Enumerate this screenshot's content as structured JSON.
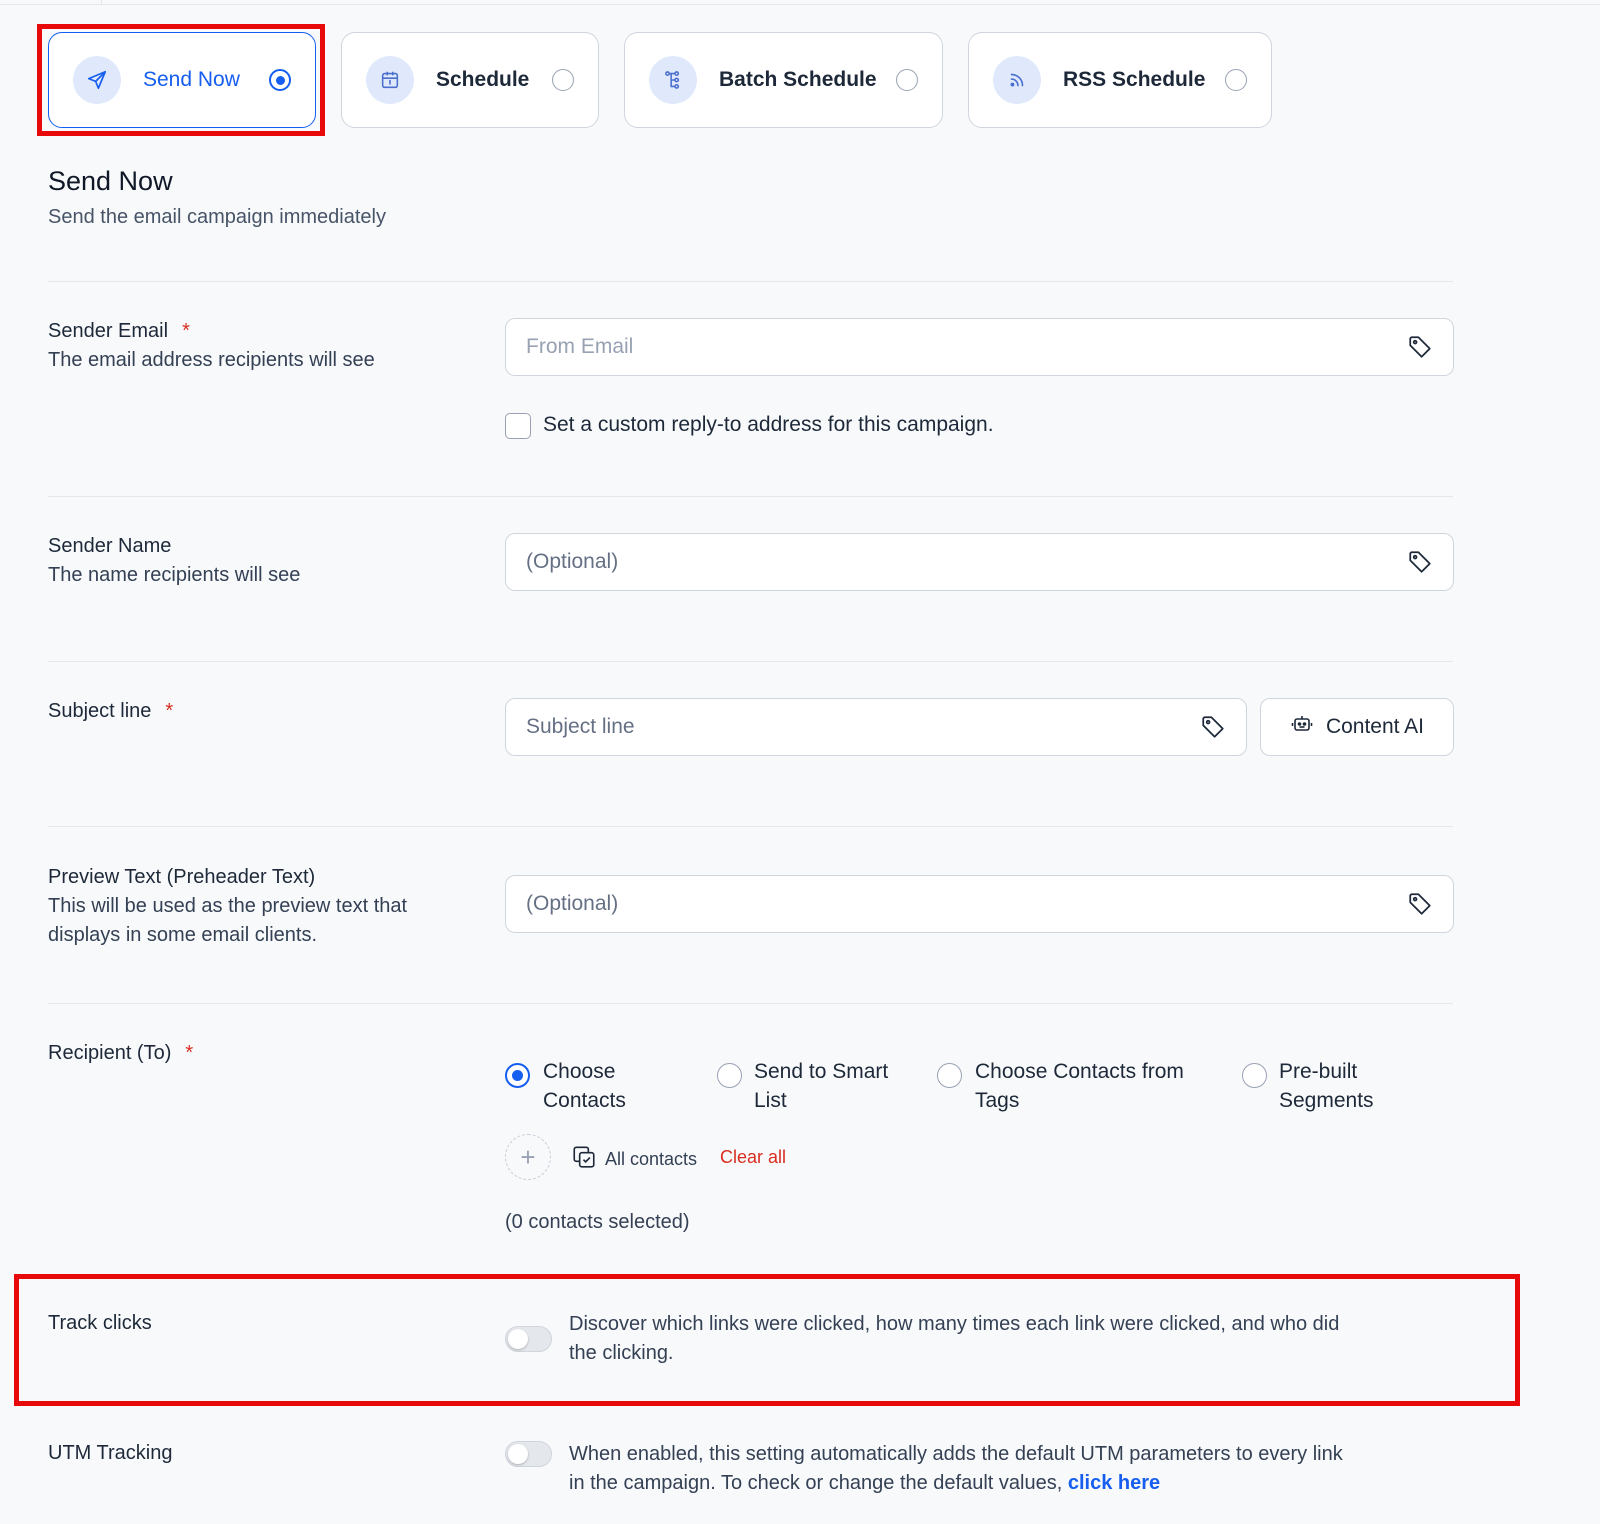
{
  "send_options": [
    {
      "label": "Send Now",
      "icon": "send-icon",
      "selected": true
    },
    {
      "label": "Schedule",
      "icon": "calendar-icon",
      "selected": false
    },
    {
      "label": "Batch Schedule",
      "icon": "batch-icon",
      "selected": false
    },
    {
      "label": "RSS Schedule",
      "icon": "rss-icon",
      "selected": false
    }
  ],
  "section": {
    "title": "Send Now",
    "subtitle": "Send the email campaign immediately"
  },
  "sender_email": {
    "label": "Sender Email",
    "required_mark": "*",
    "description": "The email address recipients will see",
    "placeholder": "From Email",
    "reply_to_label": "Set a custom reply-to address for this campaign."
  },
  "sender_name": {
    "label": "Sender Name",
    "description": "The name recipients will see",
    "placeholder": "(Optional)"
  },
  "subject": {
    "label": "Subject line",
    "required_mark": "*",
    "placeholder": "Subject line",
    "ai_button": "Content AI"
  },
  "preview_text": {
    "label": "Preview Text (Preheader Text)",
    "description_line1": "This will be used as the preview text that",
    "description_line2": "displays in some email clients.",
    "placeholder": "(Optional)"
  },
  "recipient": {
    "label": "Recipient (To)",
    "required_mark": "*",
    "options": [
      {
        "line1": "Choose",
        "line2": "Contacts",
        "selected": true
      },
      {
        "line1": "Send to Smart",
        "line2": "List",
        "selected": false
      },
      {
        "line1": "Choose Contacts from",
        "line2": "Tags",
        "selected": false
      },
      {
        "line1": "Pre-built",
        "line2": "Segments",
        "selected": false
      }
    ],
    "all_contacts": "All contacts",
    "clear_all": "Clear all",
    "selected_count": "(0 contacts selected)"
  },
  "track_clicks": {
    "label": "Track clicks",
    "enabled": false,
    "description_line1": "Discover which links were clicked, how many times each link were clicked, and who did",
    "description_line2": "the clicking."
  },
  "utm_tracking": {
    "label": "UTM Tracking",
    "enabled": false,
    "description_line1": "When enabled, this setting automatically adds the default UTM parameters to every link",
    "description_line2": "in the campaign. To check or change the default values,",
    "link_text": "click here"
  },
  "colors": {
    "accent": "#155eef",
    "highlight": "#e80a0a",
    "required": "#d92d20"
  }
}
